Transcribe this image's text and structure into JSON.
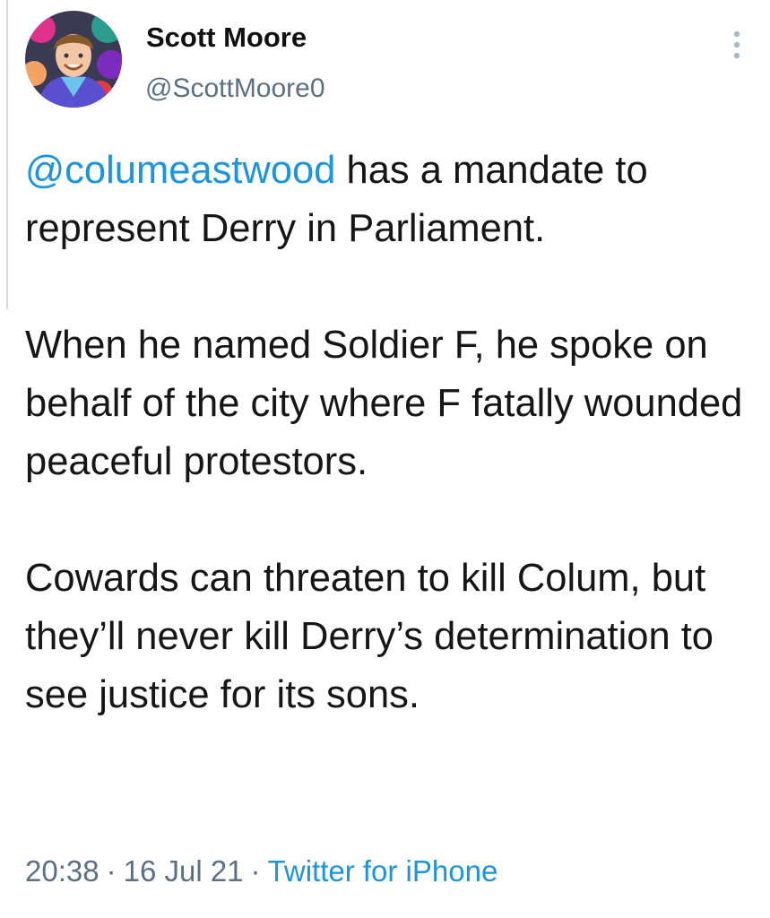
{
  "user": {
    "display_name": "Scott Moore",
    "handle": "@ScottMoore0",
    "avatar_icon": "profile-photo"
  },
  "more_icon": "vertical-ellipsis-icon",
  "tweet": {
    "mention": "@columeastwood",
    "line1_rest": " has a mandate to represent Derry in Parliament.",
    "paragraph2": "When he named Soldier F, he spoke on behalf of the city where F fatally wounded peaceful protestors.",
    "paragraph3": "Cowards can threaten to kill Colum, but they’ll never kill Derry’s determination to see justice for its sons."
  },
  "meta": {
    "time": "20:38",
    "separator": "·",
    "date": "16 Jul 21",
    "source": "Twitter for iPhone"
  },
  "colors": {
    "link": "#1b95e0",
    "secondary_text": "#5b7083",
    "primary_text": "#14171a"
  }
}
